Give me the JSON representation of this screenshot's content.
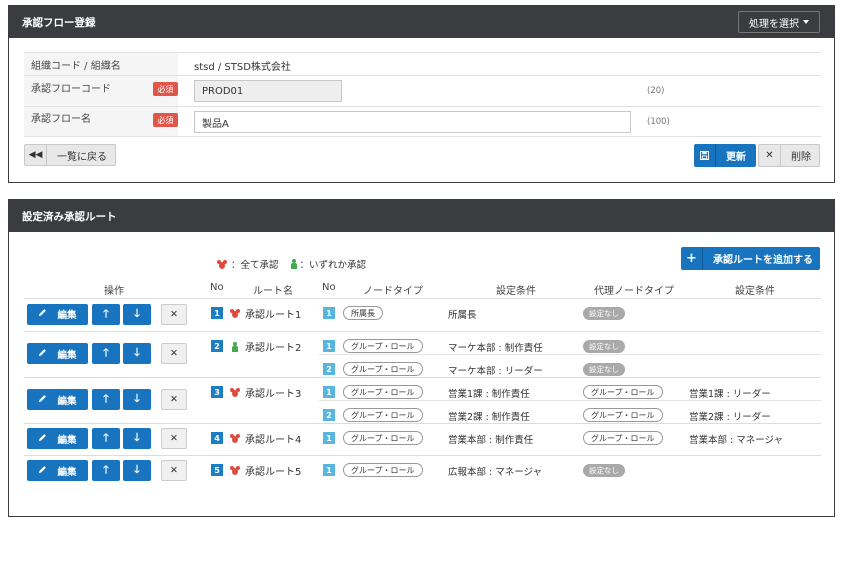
{
  "registration": {
    "title": "承認フロー登録",
    "action_select": "処理を選択",
    "fields": [
      {
        "label": "組織コード / 組織名",
        "value": "stsd / STSD株式会社"
      },
      {
        "label": "承認フローコード",
        "required": "必須",
        "value": "PROD01",
        "hint": "(20)"
      },
      {
        "label": "承認フロー名",
        "required": "必須",
        "value": "製品A",
        "hint": "(100)"
      }
    ],
    "back_label": "一覧に戻る",
    "update_label": "更新",
    "delete_label": "削除"
  },
  "routes": {
    "title": "設定済み承認ルート",
    "legend_all": "：全て承認",
    "legend_any": "：いずれか承認",
    "add_label": "承認ルートを追加する",
    "headers": [
      "操作",
      "No",
      "ルート名",
      "No",
      "ノードタイプ",
      "設定条件",
      "代理ノードタイプ",
      "設定条件"
    ],
    "edit_label": "編集",
    "no_setting": "設定なし",
    "rows": [
      {
        "no": "1",
        "type": "all",
        "name": "承認ルート1",
        "nodes": [
          {
            "no": "1",
            "node_type": "所属長",
            "condition": "所属長",
            "proxy_type": "設定なし",
            "proxy_condition": ""
          }
        ]
      },
      {
        "no": "2",
        "type": "any",
        "name": "承認ルート2",
        "nodes": [
          {
            "no": "1",
            "node_type": "グループ・ロール",
            "condition": "マーケ本部 : 制作責任",
            "proxy_type": "設定なし",
            "proxy_condition": ""
          },
          {
            "no": "2",
            "node_type": "グループ・ロール",
            "condition": "マーケ本部 : リーダー",
            "proxy_type": "設定なし",
            "proxy_condition": ""
          }
        ]
      },
      {
        "no": "3",
        "type": "all",
        "name": "承認ルート3",
        "nodes": [
          {
            "no": "1",
            "node_type": "グループ・ロール",
            "condition": "営業1課 : 制作責任",
            "proxy_type": "グループ・ロール",
            "proxy_condition": "営業1課 : リーダー"
          },
          {
            "no": "2",
            "node_type": "グループ・ロール",
            "condition": "営業2課 : 制作責任",
            "proxy_type": "グループ・ロール",
            "proxy_condition": "営業2課 : リーダー"
          }
        ]
      },
      {
        "no": "4",
        "type": "all",
        "name": "承認ルート4",
        "nodes": [
          {
            "no": "1",
            "node_type": "グループ・ロール",
            "condition": "営業本部 : 制作責任",
            "proxy_type": "グループ・ロール",
            "proxy_condition": "営業本部 : マネージャ"
          }
        ]
      },
      {
        "no": "5",
        "type": "all",
        "name": "承認ルート5",
        "nodes": [
          {
            "no": "1",
            "node_type": "グループ・ロール",
            "condition": "広報本部 : マネージャ",
            "proxy_type": "設定なし",
            "proxy_condition": ""
          }
        ]
      }
    ]
  },
  "colors": {
    "primary": "#1874be",
    "header_bg": "#3a3c40",
    "required": "#e0564b",
    "all_icon": "#e04a3f",
    "any_icon": "#3faa4e"
  }
}
